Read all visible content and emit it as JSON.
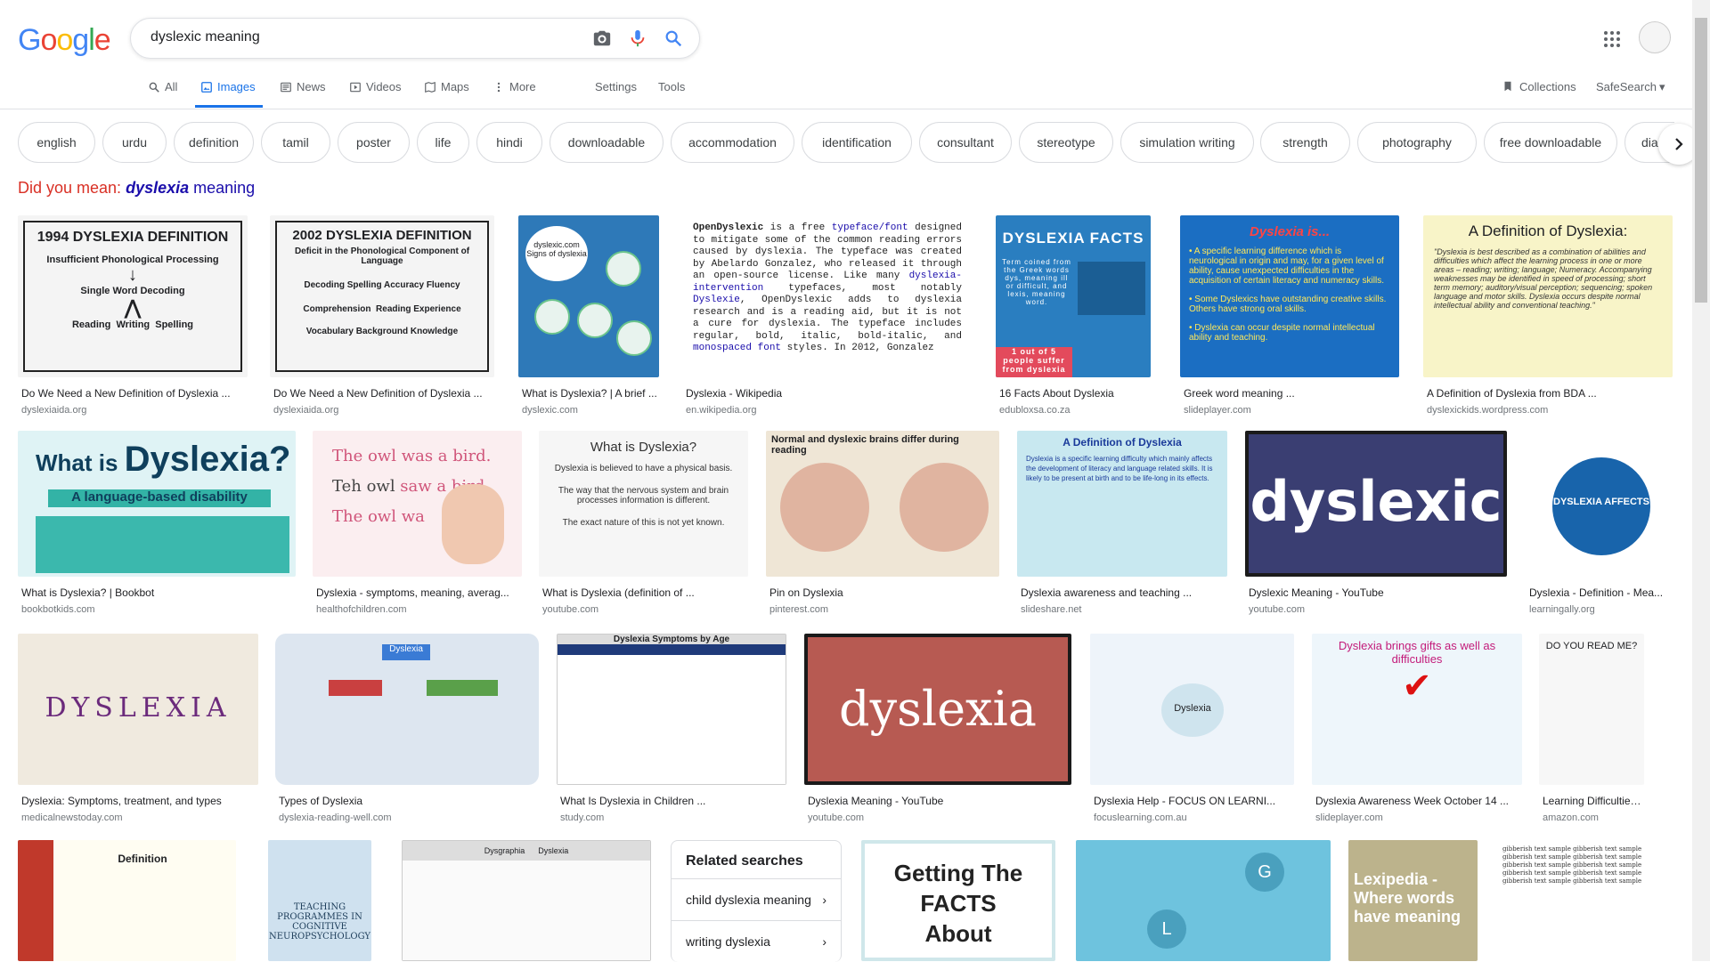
{
  "search": {
    "query": "dyslexic meaning"
  },
  "logo": {
    "text": [
      "G",
      "o",
      "o",
      "g",
      "l",
      "e"
    ],
    "colors": [
      "#4285f4",
      "#ea4335",
      "#fbbc05",
      "#4285f4",
      "#34a853",
      "#ea4335"
    ]
  },
  "tabs": [
    {
      "label": "All",
      "icon": "search-icon"
    },
    {
      "label": "Images",
      "icon": "image-icon"
    },
    {
      "label": "News",
      "icon": "news-icon"
    },
    {
      "label": "Videos",
      "icon": "video-icon"
    },
    {
      "label": "Maps",
      "icon": "map-icon"
    },
    {
      "label": "More",
      "icon": "more-vert-icon"
    }
  ],
  "tools": {
    "settings": "Settings",
    "tools": "Tools",
    "collections": "Collections",
    "safesearch": "SafeSearch"
  },
  "chips": [
    "english",
    "urdu",
    "definition",
    "tamil",
    "poster",
    "life",
    "hindi",
    "downloadable",
    "accommodation",
    "identification",
    "consultant",
    "stereotype",
    "simulation writing",
    "strength",
    "photography",
    "free downloadable",
    "diagn"
  ],
  "did_you_mean": {
    "prefix": "Did you mean:",
    "term": "dyslexia",
    "rest": " meaning"
  },
  "results": [
    {
      "title": "Do We Need a New Definition of Dyslexia ...",
      "source": "dyslexiaida.org",
      "img_text": "1994 DYSLEXIA DEFINITION"
    },
    {
      "title": "Do We Need a New Definition of Dyslexia ...",
      "source": "dyslexiaida.org",
      "img_text": "2002 DYSLEXIA DEFINITION"
    },
    {
      "title": "What is Dyslexia? | A brief ...",
      "source": "dyslexic.com",
      "img_text": "dyslexic.com"
    },
    {
      "title": "Dyslexia - Wikipedia",
      "source": "en.wikipedia.org",
      "img_text": "OpenDyslexic is a free typeface/font designed to mitigate some of the common reading errors caused by dyslexia."
    },
    {
      "title": "16 Facts About Dyslexia",
      "source": "edubloxsa.co.za",
      "img_text": "DYSLEXIA FACTS"
    },
    {
      "title": "Greek word meaning ...",
      "source": "slideplayer.com",
      "img_text": "Dyslexia is..."
    },
    {
      "title": "A Definition of Dyslexia from BDA ...",
      "source": "dyslexickids.wordpress.com",
      "img_text": "A Definition of Dyslexia:"
    },
    {
      "title": "What is Dyslexia? | Bookbot",
      "source": "bookbotkids.com",
      "img_text": "What is Dyslexia?"
    },
    {
      "title": "Dyslexia - symptoms, meaning, averag...",
      "source": "healthofchildren.com",
      "img_text": "The owl was a bird."
    },
    {
      "title": "What is Dyslexia (definition of ...",
      "source": "youtube.com",
      "img_text": "What is Dyslexia?"
    },
    {
      "title": "Pin on Dyslexia",
      "source": "pinterest.com",
      "img_text": "Normal and dyslexic brains differ during reading"
    },
    {
      "title": "Dyslexia awareness and teaching ...",
      "source": "slideshare.net",
      "img_text": "A Definition of Dyslexia"
    },
    {
      "title": "Dyslexic Meaning - YouTube",
      "source": "youtube.com",
      "img_text": "dyslexic"
    },
    {
      "title": "Dyslexia - Definition - Mea...",
      "source": "learningally.org",
      "img_text": "DYSLEXIA AFFECTS"
    },
    {
      "title": "Dyslexia: Symptoms, treatment, and types",
      "source": "medicalnewstoday.com",
      "img_text": "DYSLEXIA"
    },
    {
      "title": "Types of Dyslexia",
      "source": "dyslexia-reading-well.com",
      "img_text": "Dyslexia"
    },
    {
      "title": "What Is Dyslexia in Children ...",
      "source": "study.com",
      "img_text": "Dyslexia Symptoms by Age"
    },
    {
      "title": "Dyslexia Meaning - YouTube",
      "source": "youtube.com",
      "img_text": "dyslexia"
    },
    {
      "title": "Dyslexia Help - FOCUS ON LEARNI...",
      "source": "focuslearning.com.au",
      "img_text": "Dyslexia"
    },
    {
      "title": "Dyslexia Awareness Week October 14 ...",
      "source": "slideplayer.com",
      "img_text": "Dyslexia brings gifts as well as difficulties"
    },
    {
      "title": "Learning Difficulties, Dy...",
      "source": "amazon.com",
      "img_text": "DO YOU READ ME?"
    },
    {
      "title": "",
      "source": "",
      "img_text": "Definition"
    },
    {
      "title": "",
      "source": "",
      "img_text": "TEACHING PROGRAMMES IN COGNITIVE NEUROPSYCHOLOGY"
    },
    {
      "title": "",
      "source": "",
      "img_text": "Dysgraphia"
    },
    {
      "title": "",
      "source": "",
      "img_text": "Getting The FACTS About"
    },
    {
      "title": "",
      "source": "",
      "img_text": "G"
    },
    {
      "title": "",
      "source": "",
      "img_text": "Lexipedia - Where words have meaning"
    },
    {
      "title": "",
      "source": "",
      "img_text": ""
    }
  ],
  "related": {
    "title": "Related searches",
    "items": [
      "child dyslexia meaning",
      "writing dyslexia"
    ]
  }
}
